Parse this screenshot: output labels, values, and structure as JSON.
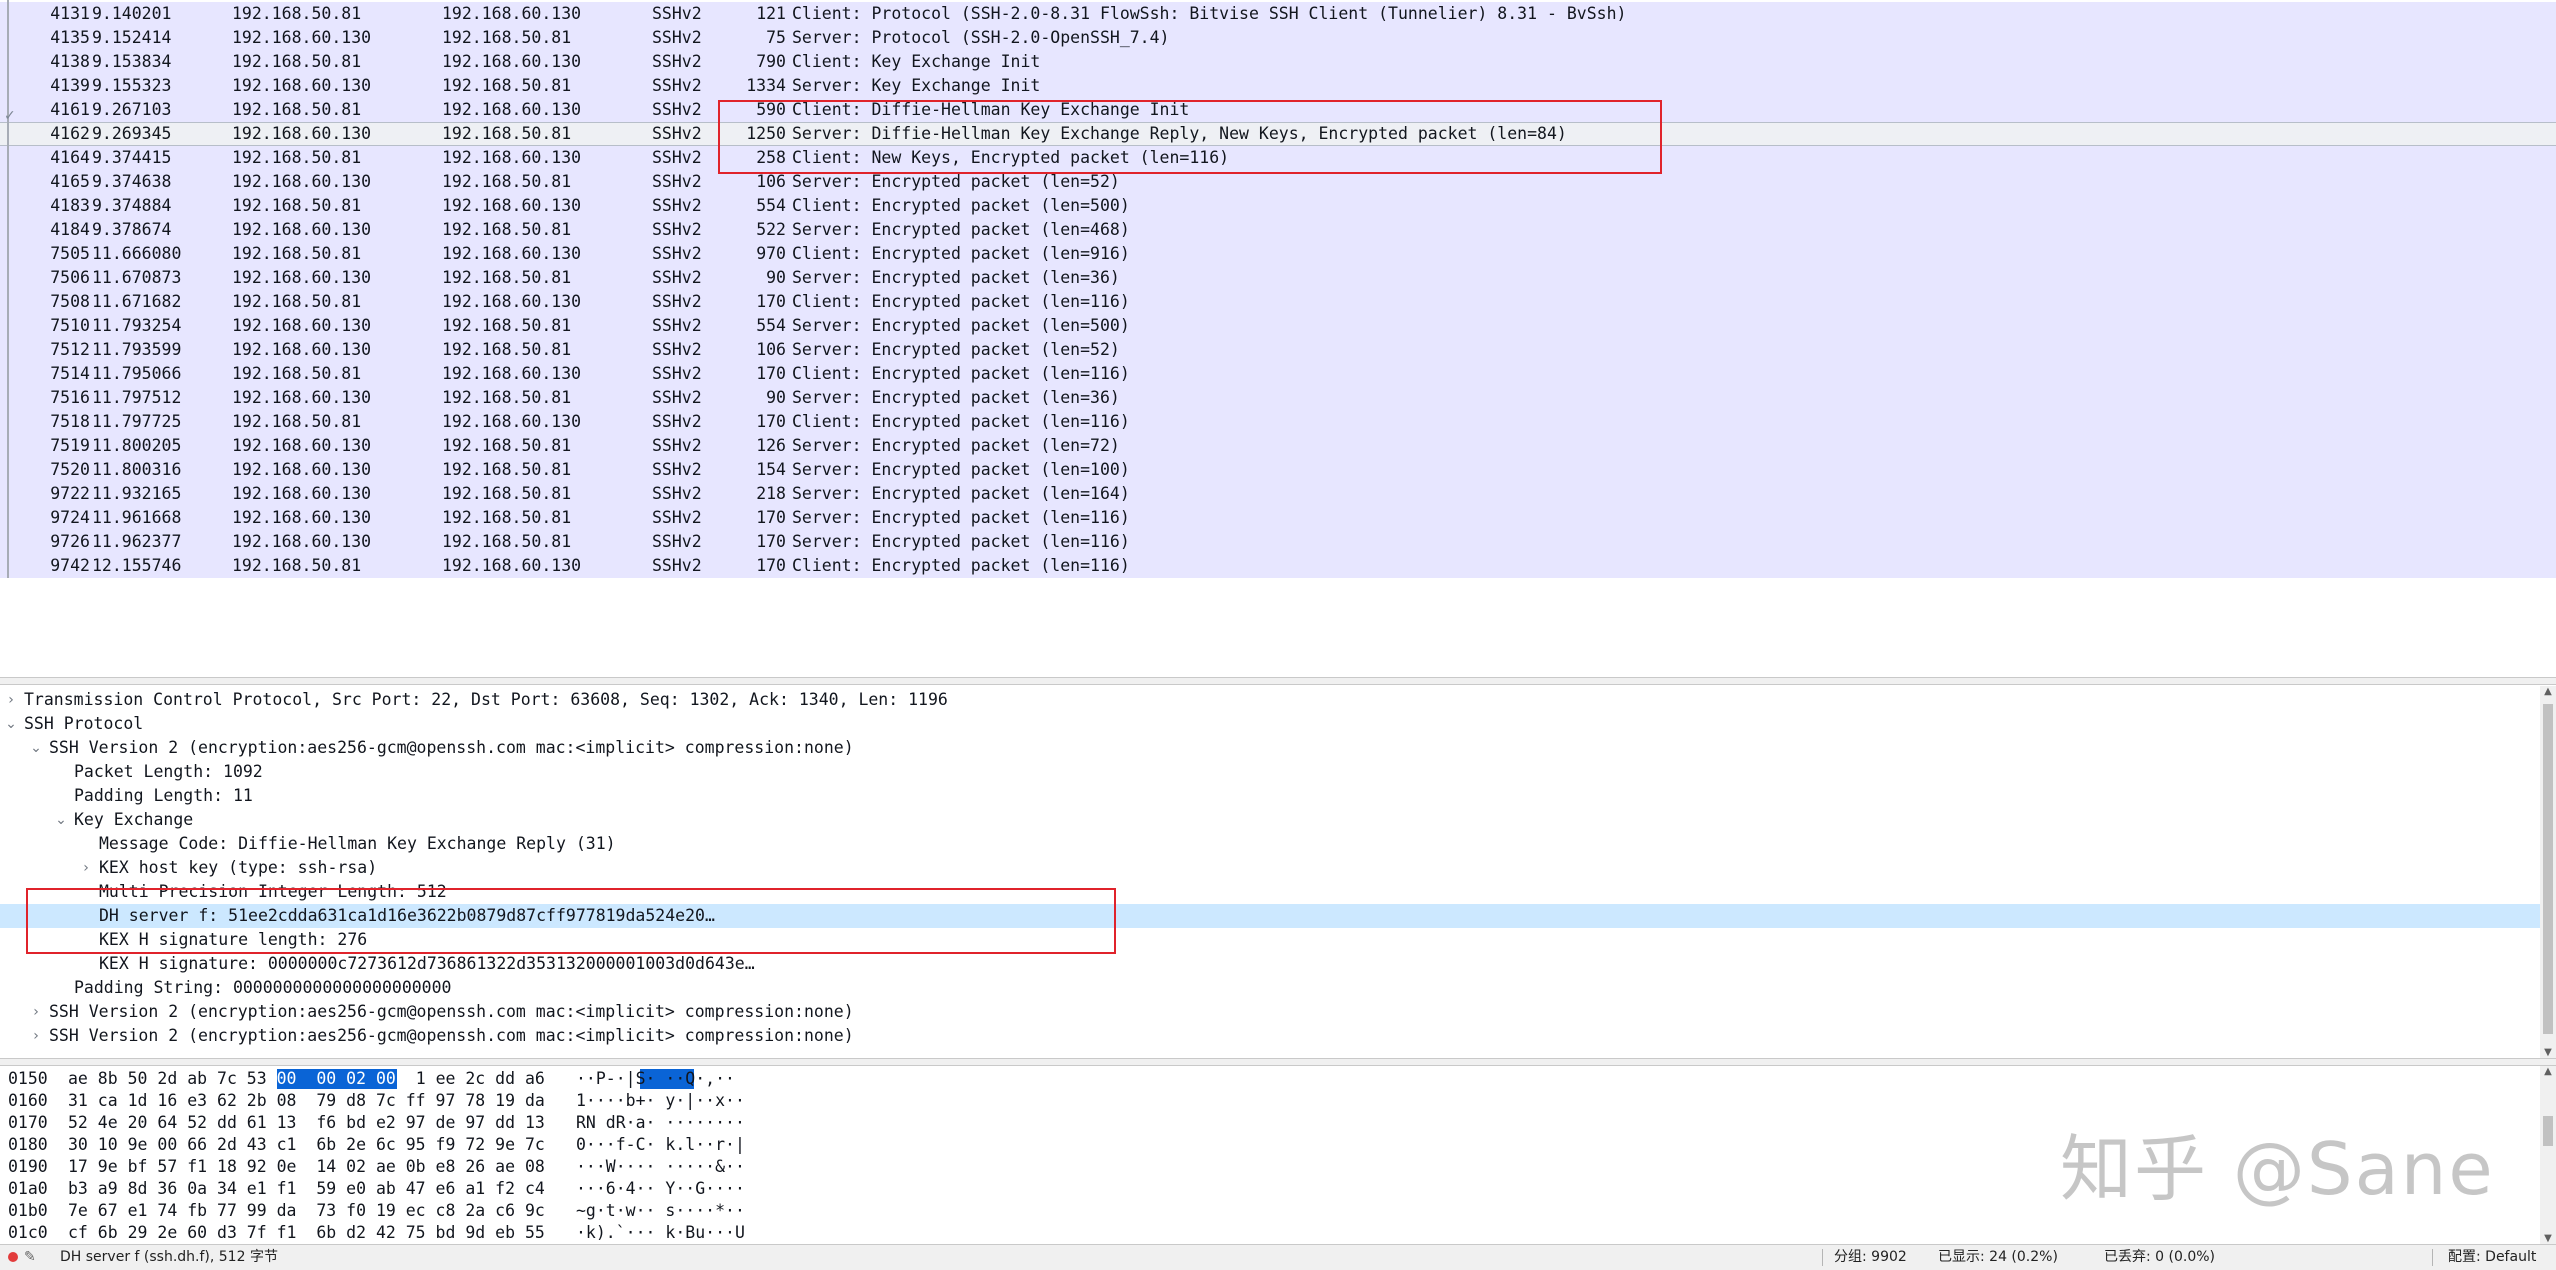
{
  "packets": [
    {
      "no": "4131",
      "time": "9.140201",
      "src": "192.168.50.81",
      "dst": "192.168.60.130",
      "proto": "SSHv2",
      "len": "121",
      "info": "Client: Protocol (SSH-2.0-8.31 FlowSsh: Bitvise SSH Client (Tunnelier) 8.31 - BvSsh)"
    },
    {
      "no": "4135",
      "time": "9.152414",
      "src": "192.168.60.130",
      "dst": "192.168.50.81",
      "proto": "SSHv2",
      "len": "75",
      "info": "Server: Protocol (SSH-2.0-OpenSSH_7.4)"
    },
    {
      "no": "4138",
      "time": "9.153834",
      "src": "192.168.50.81",
      "dst": "192.168.60.130",
      "proto": "SSHv2",
      "len": "790",
      "info": "Client: Key Exchange Init"
    },
    {
      "no": "4139",
      "time": "9.155323",
      "src": "192.168.60.130",
      "dst": "192.168.50.81",
      "proto": "SSHv2",
      "len": "1334",
      "info": "Server: Key Exchange Init"
    },
    {
      "no": "4161",
      "time": "9.267103",
      "src": "192.168.50.81",
      "dst": "192.168.60.130",
      "proto": "SSHv2",
      "len": "590",
      "info": "Client: Diffie-Hellman Key Exchange Init"
    },
    {
      "no": "4162",
      "time": "9.269345",
      "src": "192.168.60.130",
      "dst": "192.168.50.81",
      "proto": "SSHv2",
      "len": "1250",
      "info": "Server: Diffie-Hellman Key Exchange Reply, New Keys, Encrypted packet (len=84)"
    },
    {
      "no": "4164",
      "time": "9.374415",
      "src": "192.168.50.81",
      "dst": "192.168.60.130",
      "proto": "SSHv2",
      "len": "258",
      "info": "Client: New Keys, Encrypted packet (len=116)"
    },
    {
      "no": "4165",
      "time": "9.374638",
      "src": "192.168.60.130",
      "dst": "192.168.50.81",
      "proto": "SSHv2",
      "len": "106",
      "info": "Server: Encrypted packet (len=52)"
    },
    {
      "no": "4183",
      "time": "9.374884",
      "src": "192.168.50.81",
      "dst": "192.168.60.130",
      "proto": "SSHv2",
      "len": "554",
      "info": "Client: Encrypted packet (len=500)"
    },
    {
      "no": "4184",
      "time": "9.378674",
      "src": "192.168.60.130",
      "dst": "192.168.50.81",
      "proto": "SSHv2",
      "len": "522",
      "info": "Server: Encrypted packet (len=468)"
    },
    {
      "no": "7505",
      "time": "11.666080",
      "src": "192.168.50.81",
      "dst": "192.168.60.130",
      "proto": "SSHv2",
      "len": "970",
      "info": "Client: Encrypted packet (len=916)"
    },
    {
      "no": "7506",
      "time": "11.670873",
      "src": "192.168.60.130",
      "dst": "192.168.50.81",
      "proto": "SSHv2",
      "len": "90",
      "info": "Server: Encrypted packet (len=36)"
    },
    {
      "no": "7508",
      "time": "11.671682",
      "src": "192.168.50.81",
      "dst": "192.168.60.130",
      "proto": "SSHv2",
      "len": "170",
      "info": "Client: Encrypted packet (len=116)"
    },
    {
      "no": "7510",
      "time": "11.793254",
      "src": "192.168.60.130",
      "dst": "192.168.50.81",
      "proto": "SSHv2",
      "len": "554",
      "info": "Server: Encrypted packet (len=500)"
    },
    {
      "no": "7512",
      "time": "11.793599",
      "src": "192.168.60.130",
      "dst": "192.168.50.81",
      "proto": "SSHv2",
      "len": "106",
      "info": "Server: Encrypted packet (len=52)"
    },
    {
      "no": "7514",
      "time": "11.795066",
      "src": "192.168.50.81",
      "dst": "192.168.60.130",
      "proto": "SSHv2",
      "len": "170",
      "info": "Client: Encrypted packet (len=116)"
    },
    {
      "no": "7516",
      "time": "11.797512",
      "src": "192.168.60.130",
      "dst": "192.168.50.81",
      "proto": "SSHv2",
      "len": "90",
      "info": "Server: Encrypted packet (len=36)"
    },
    {
      "no": "7518",
      "time": "11.797725",
      "src": "192.168.50.81",
      "dst": "192.168.60.130",
      "proto": "SSHv2",
      "len": "170",
      "info": "Client: Encrypted packet (len=116)"
    },
    {
      "no": "7519",
      "time": "11.800205",
      "src": "192.168.60.130",
      "dst": "192.168.50.81",
      "proto": "SSHv2",
      "len": "126",
      "info": "Server: Encrypted packet (len=72)"
    },
    {
      "no": "7520",
      "time": "11.800316",
      "src": "192.168.60.130",
      "dst": "192.168.50.81",
      "proto": "SSHv2",
      "len": "154",
      "info": "Server: Encrypted packet (len=100)"
    },
    {
      "no": "9722",
      "time": "11.932165",
      "src": "192.168.60.130",
      "dst": "192.168.50.81",
      "proto": "SSHv2",
      "len": "218",
      "info": "Server: Encrypted packet (len=164)"
    },
    {
      "no": "9724",
      "time": "11.961668",
      "src": "192.168.60.130",
      "dst": "192.168.50.81",
      "proto": "SSHv2",
      "len": "170",
      "info": "Server: Encrypted packet (len=116)"
    },
    {
      "no": "9726",
      "time": "11.962377",
      "src": "192.168.60.130",
      "dst": "192.168.50.81",
      "proto": "SSHv2",
      "len": "170",
      "info": "Server: Encrypted packet (len=116)"
    },
    {
      "no": "9742",
      "time": "12.155746",
      "src": "192.168.50.81",
      "dst": "192.168.60.130",
      "proto": "SSHv2",
      "len": "170",
      "info": "Client: Encrypted packet (len=116)"
    }
  ],
  "selected_packet": "4162",
  "details": [
    {
      "depth": 0,
      "arrow": "right",
      "text": "Transmission Control Protocol, Src Port: 22, Dst Port: 63608, Seq: 1302, Ack: 1340, Len: 1196"
    },
    {
      "depth": 0,
      "arrow": "down",
      "text": "SSH Protocol"
    },
    {
      "depth": 1,
      "arrow": "down",
      "text": "SSH Version 2 (encryption:aes256-gcm@openssh.com mac:<implicit> compression:none)"
    },
    {
      "depth": 2,
      "arrow": "",
      "text": "Packet Length: 1092"
    },
    {
      "depth": 2,
      "arrow": "",
      "text": "Padding Length: 11"
    },
    {
      "depth": 2,
      "arrow": "down",
      "text": "Key Exchange"
    },
    {
      "depth": 3,
      "arrow": "",
      "text": "Message Code: Diffie-Hellman Key Exchange Reply (31)"
    },
    {
      "depth": 3,
      "arrow": "right",
      "text": "KEX host key (type: ssh-rsa)"
    },
    {
      "depth": 3,
      "arrow": "",
      "text": "Multi Precision Integer Length: 512"
    },
    {
      "depth": 3,
      "arrow": "",
      "text": "DH server f: 51ee2cdda631ca1d16e3622b0879d87cff977819da524e20…",
      "selected": true
    },
    {
      "depth": 3,
      "arrow": "",
      "text": "KEX H signature length: 276"
    },
    {
      "depth": 3,
      "arrow": "",
      "text": "KEX H signature: 0000000c7273612d736861322d353132000001003d0d643e…"
    },
    {
      "depth": 2,
      "arrow": "",
      "text": "Padding String: 0000000000000000000000"
    },
    {
      "depth": 1,
      "arrow": "right",
      "text": "SSH Version 2 (encryption:aes256-gcm@openssh.com mac:<implicit> compression:none)"
    },
    {
      "depth": 1,
      "arrow": "right",
      "text": "SSH Version 2 (encryption:aes256-gcm@openssh.com mac:<implicit> compression:none)"
    }
  ],
  "bytes": [
    {
      "offset": "0150",
      "hex": "ae 8b 50 2d ab 7c 53 00  00 02 00 51 ee 2c dd a6",
      "ascii": "··P-·|S· ··Q·,··"
    },
    {
      "offset": "0160",
      "hex": "31 ca 1d 16 e3 62 2b 08  79 d8 7c ff 97 78 19 da",
      "ascii": "1····b+· y·|··x··"
    },
    {
      "offset": "0170",
      "hex": "52 4e 20 64 52 dd 61 13  f6 bd e2 97 de 97 dd 13",
      "ascii": "RN dR·a· ········"
    },
    {
      "offset": "0180",
      "hex": "30 10 9e 00 66 2d 43 c1  6b 2e 6c 95 f9 72 9e 7c",
      "ascii": "0···f-C· k.l··r·|"
    },
    {
      "offset": "0190",
      "hex": "17 9e bf 57 f1 18 92 0e  14 02 ae 0b e8 26 ae 08",
      "ascii": "···W···· ·····&··"
    },
    {
      "offset": "01a0",
      "hex": "b3 a9 8d 36 0a 34 e1 f1  59 e0 ab 47 e6 a1 f2 c4",
      "ascii": "···6·4·· Y··G····"
    },
    {
      "offset": "01b0",
      "hex": "7e 67 e1 74 fb 77 99 da  73 f0 19 ec c8 2a c6 9c",
      "ascii": "~g·t·w·· s····*··"
    },
    {
      "offset": "01c0",
      "hex": "cf 6b 29 2e 60 d3 7f f1  6b d2 42 75 bd 9d eb 55",
      "ascii": "·k).`··· k·Bu···U"
    }
  ],
  "watermark": "知乎 @Sane",
  "status": {
    "field_info": "DH server f (ssh.dh.f), 512 字节",
    "packets": "分组: 9902",
    "displayed": "已显示: 24 (0.2%)",
    "dropped": "已丢弃: 0 (0.0%)",
    "profile": "配置: Default"
  },
  "colors": {
    "row_bg": "#e7e6ff",
    "selected_row_bg": "#eef0f4",
    "detail_selected_bg": "#cce8ff",
    "byte_highlight": "#0a64d6",
    "annotation_box": "#e0232b"
  }
}
